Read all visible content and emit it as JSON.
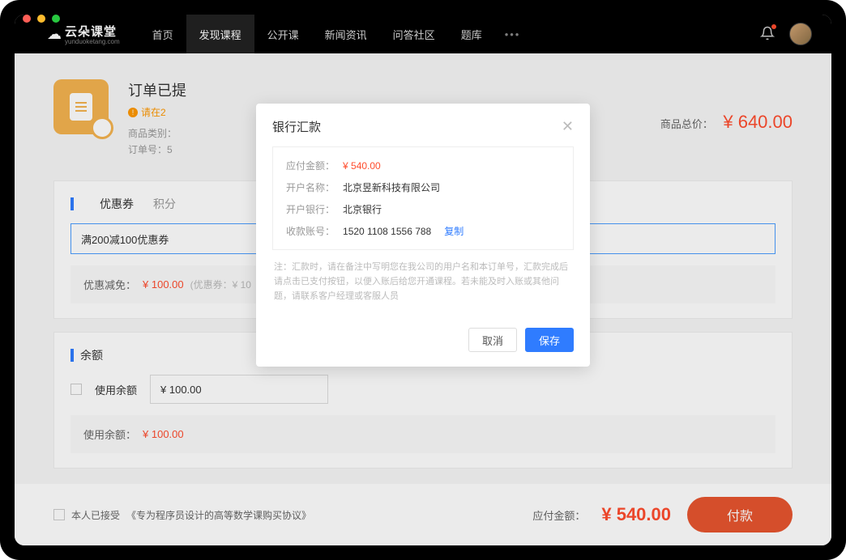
{
  "logo": {
    "name": "云朵课堂",
    "sub": "yunduoketang.com"
  },
  "nav": {
    "items": [
      "首页",
      "发现课程",
      "公开课",
      "新闻资讯",
      "问答社区",
      "题库"
    ],
    "active_index": 1
  },
  "order": {
    "title": "订单已提",
    "warn": "请在2",
    "meta_category_label": "商品类别：",
    "meta_ordernum_label": "订单号：5",
    "total_label": "商品总价：",
    "total_value": "¥ 640.00"
  },
  "coupon": {
    "tab1": "优惠券",
    "tab2": "积分",
    "selected": "满200减100优惠券",
    "discount_label": "优惠减免：",
    "discount_value": "¥ 100.00",
    "discount_note": "(优惠券：¥ 10"
  },
  "balance": {
    "head": "余额",
    "checkbox_label": "使用余额",
    "input_value": "¥ 100.00",
    "use_label": "使用余额：",
    "use_value": "¥ 100.00"
  },
  "footer": {
    "agree_prefix": "本人已接受",
    "agree_link": "《专为程序员设计的高等数学课购买协议》",
    "pay_label": "应付金额：",
    "pay_amount": "¥ 540.00",
    "pay_button": "付款"
  },
  "modal": {
    "title": "银行汇款",
    "amount_label": "应付金额：",
    "amount_value": "¥ 540.00",
    "account_name_label": "开户名称：",
    "account_name_value": "北京昱新科技有限公司",
    "bank_label": "开户银行：",
    "bank_value": "北京银行",
    "account_no_label": "收款账号：",
    "account_no_value": "1520 1108 1556 788",
    "copy": "复制",
    "note": "注：汇款时，请在备注中写明您在我公司的用户名和本订单号，汇款完成后请点击已支付按钮，以便入账后给您开通课程。若未能及时入账或其他问题，请联系客户经理或客服人员",
    "cancel": "取消",
    "save": "保存"
  }
}
